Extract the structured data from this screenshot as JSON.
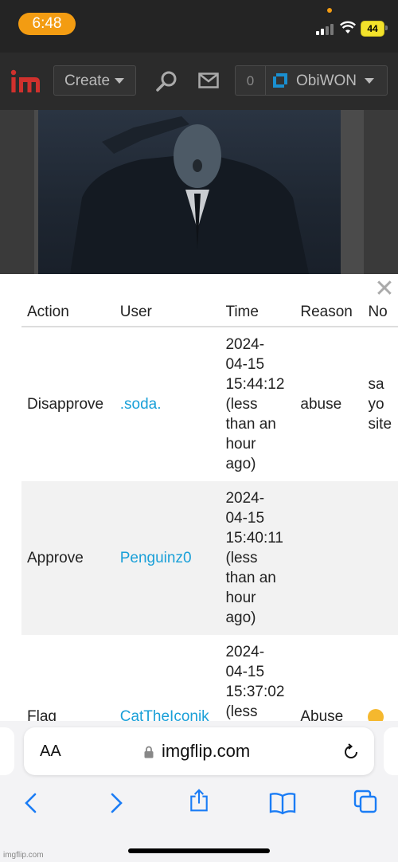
{
  "status_bar": {
    "time": "6:48",
    "battery": "44"
  },
  "header": {
    "logo": "im",
    "create_label": "Create",
    "notifications_count": "0",
    "username": "ObiWON"
  },
  "modal": {
    "close_symbol": "✕",
    "columns": [
      "Action",
      "User",
      "Time",
      "Reason",
      "No"
    ],
    "rows": [
      {
        "action": "Disapprove",
        "user": ".soda.",
        "time": [
          "2024-",
          "04-15",
          "15:44:12",
          "(less",
          "than an",
          "hour",
          "ago)"
        ],
        "reason": "abuse",
        "note": [
          "sa",
          "yo",
          "site"
        ]
      },
      {
        "action": "Approve",
        "user": "Penguinz0",
        "time": [
          "2024-",
          "04-15",
          "15:40:11",
          "(less",
          "than an",
          "hour",
          "ago)"
        ],
        "reason": "",
        "note": []
      },
      {
        "action": "Flag",
        "user": "CatTheIconik",
        "time": [
          "2024-",
          "04-15",
          "15:37:02",
          "(less"
        ],
        "reason": "Abuse",
        "note": []
      }
    ]
  },
  "browser": {
    "aa_label": "AA",
    "url": "imgflip.com"
  },
  "watermark": "imgflip.com",
  "icons": {
    "search": "magnifier",
    "mail": "envelope",
    "close": "x",
    "lock": "padlock",
    "reload": "circular-arrow",
    "back": "chevron-left",
    "forward": "chevron-right",
    "share": "share",
    "bookmarks": "open-book",
    "tabs": "two-squares"
  },
  "colors": {
    "time_pill": "#f39c12",
    "battery": "#f3e22b",
    "link": "#1aa0d8",
    "logo_red": "#d0312d",
    "avatar": "#1a8fd0"
  }
}
